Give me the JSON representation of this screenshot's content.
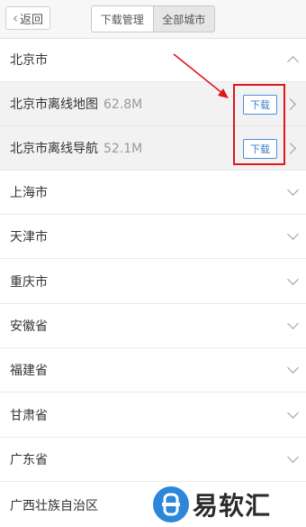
{
  "header": {
    "back_label": "返回",
    "tabs": [
      {
        "label": "下载管理",
        "active": false
      },
      {
        "label": "全部城市",
        "active": true
      }
    ]
  },
  "cities": {
    "expanded": {
      "name": "北京市",
      "packages": [
        {
          "name": "北京市离线地图",
          "size": "62.8M",
          "button": "下载"
        },
        {
          "name": "北京市离线导航",
          "size": "52.1M",
          "button": "下载"
        }
      ]
    },
    "others": [
      "上海市",
      "天津市",
      "重庆市",
      "安徽省",
      "福建省",
      "甘肃省",
      "广东省",
      "广西壮族自治区"
    ]
  },
  "watermark": {
    "text": "易软汇"
  },
  "colors": {
    "accent_blue": "#3a7fc9",
    "annotation_red": "#e0171c"
  }
}
